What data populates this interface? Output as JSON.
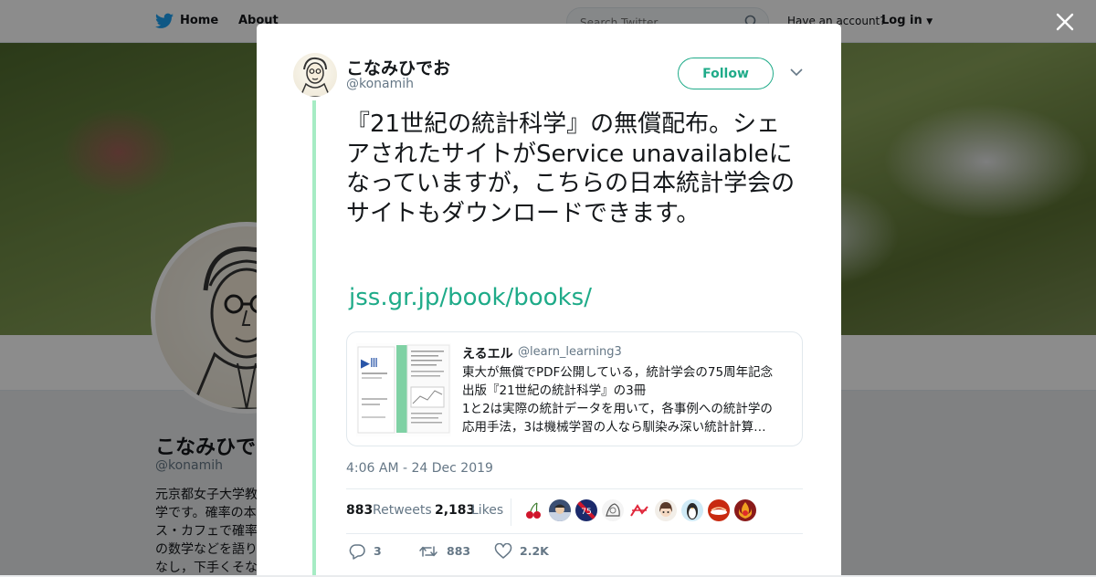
{
  "nav": {
    "home": "Home",
    "about": "About",
    "search_placeholder": "Search Twitter",
    "have_account": "Have an account?",
    "login": "Log in"
  },
  "background_profile": {
    "name": "こなみひでお",
    "handle": "@konamih",
    "bio": "元京都女子大学教学です。確率の本ス・カフェで確率の数学などを語りなし，下手くそな"
  },
  "tweet": {
    "author_name": "こなみひでお",
    "author_handle": "@konamih",
    "follow_label": "Follow",
    "text": "『21世紀の統計科学』の無償配布。シェアされたサイトがService unavailableになっていますが，こちらの日本統計学会のサイトもダウンロードできます。",
    "link": "jss.gr.jp/book/books/",
    "timestamp": "4:06 AM - 24 Dec 2019",
    "retweets_count": "883",
    "retweets_label": "Retweets",
    "likes_count": "2,183",
    "likes_label": "Likes",
    "reply_count": "3",
    "retweet_action_count": "883",
    "like_action_count": "2.2K"
  },
  "quote": {
    "name": "えるエル",
    "handle": "@learn_learning3",
    "lines": [
      "東大が無償でPDF公開している，統計学会の75周年記念",
      "出版『21世紀の統計科学』の3冊",
      "1と2は実際の統計データを用いて，各事例への統計学の",
      "応用手法，3は機械学習の人なら馴染み深い統計計算…"
    ]
  },
  "colors": {
    "accent": "#1fab89",
    "thread_line": "#a6ecc4",
    "twitter_blue": "#1da1f2"
  },
  "likers": [
    "cherries-avatar",
    "anime-avatar",
    "ds-avatar",
    "sketch-avatar",
    "logo-avatar",
    "girl-avatar",
    "penguin-avatar",
    "red-avatar",
    "flame-avatar"
  ]
}
